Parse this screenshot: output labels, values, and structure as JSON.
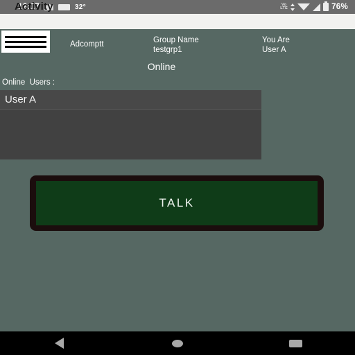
{
  "status_bar": {
    "time": "12:17",
    "temperature": "32°",
    "network_label_top": "Vo",
    "network_label_bottom": "LTE",
    "battery_percent": "76%",
    "icons": [
      "photo-icon",
      "card-icon",
      "volte-icon",
      "data-transfer-icon",
      "wifi-icon",
      "signal-icon",
      "battery-icon"
    ],
    "background": "#6b6b6b"
  },
  "window": {
    "title": "Activity",
    "header_background": "#f2f2f0",
    "app_background": "#566863"
  },
  "toolbar": {
    "menu_label": "menu-icon",
    "app_name": "Adcomptt",
    "group_label": "Group Name",
    "group_value": "testgrp1",
    "you_label": "You Are",
    "you_value": "User A"
  },
  "main": {
    "status_heading": "Online",
    "users_label": "Online  Users :",
    "users": [
      "User A"
    ],
    "list_background": "#414141",
    "row_background": "#484848"
  },
  "talk": {
    "label": "TALK",
    "fill_color": "#0f3c18",
    "border_color": "#1b0d0d"
  },
  "nav_bar": {
    "back": "back-icon",
    "home": "home-icon",
    "recents": "recents-icon",
    "background": "#000000"
  }
}
